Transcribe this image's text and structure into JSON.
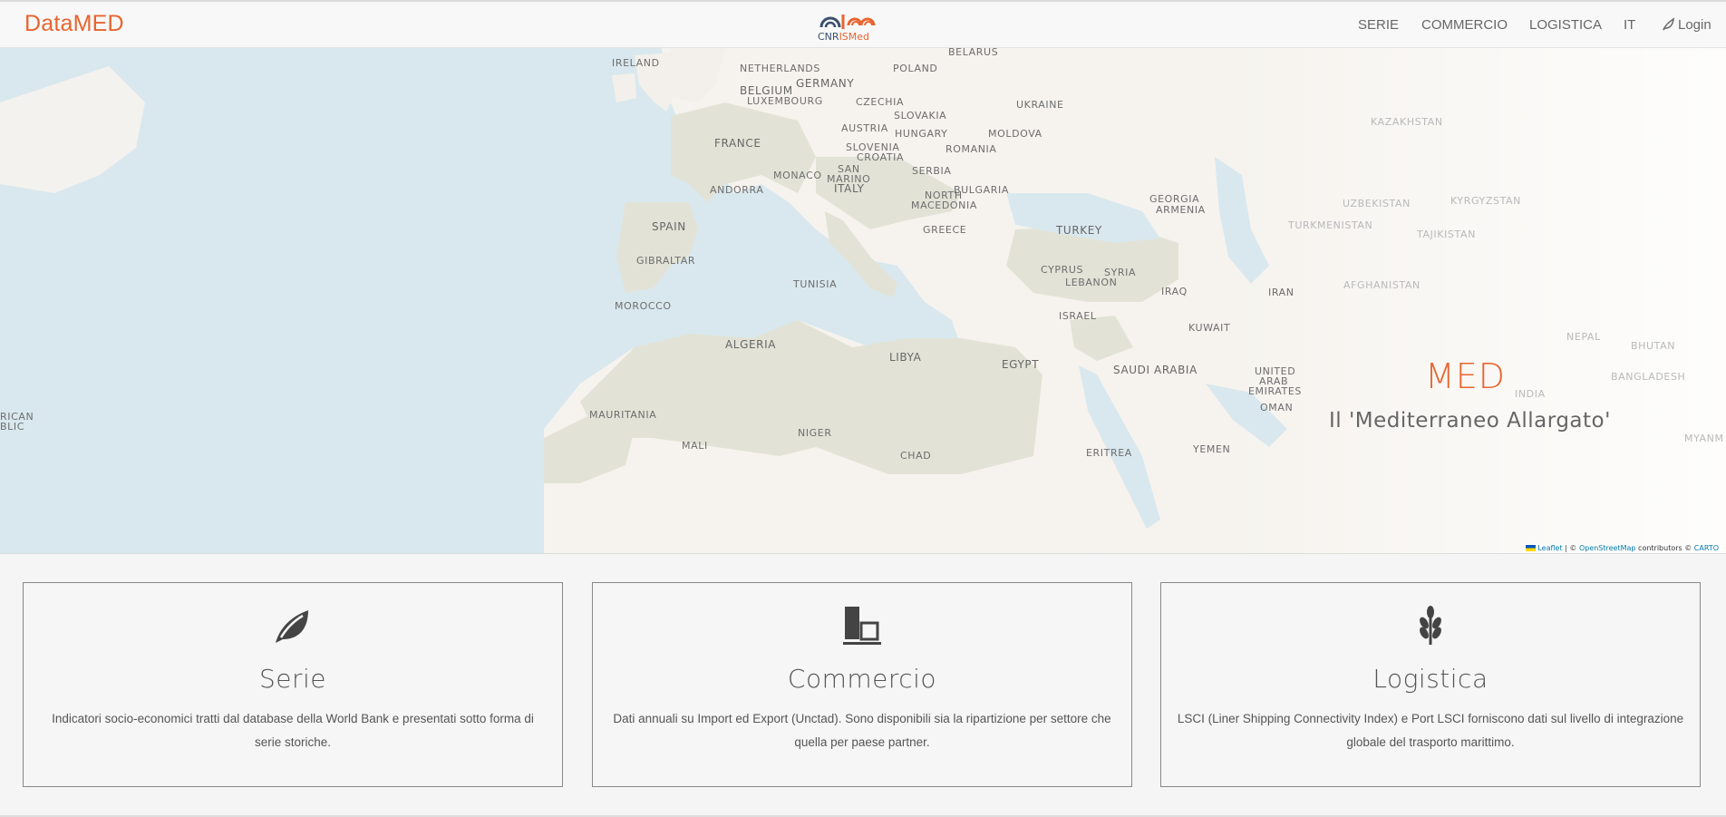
{
  "brand": "DataMED",
  "logo": {
    "left": "CNR",
    "right": "ISMed"
  },
  "nav": {
    "serie": "SERIE",
    "commercio": "COMMERCIO",
    "logistica": "LOGISTICA",
    "lang": "IT",
    "login": "Login"
  },
  "hero": {
    "title": "MED",
    "subtitle": "Il 'Mediterraneo Allargato'"
  },
  "map_labels": {
    "ireland": "IRELAND",
    "belarus": "BELARUS",
    "netherlands": "NETHERLANDS",
    "germany": "GERMANY",
    "poland": "POLAND",
    "belgium": "BELGIUM",
    "luxembourg": "LUXEMBOURG",
    "czechia": "CZECHIA",
    "ukraine": "UKRAINE",
    "slovakia": "SLOVAKIA",
    "austria": "AUSTRIA",
    "hungary": "HUNGARY",
    "moldova": "MOLDOVA",
    "kazakhstan": "KAZAKHSTAN",
    "france": "FRANCE",
    "slovenia": "SLOVENIA",
    "croatia": "CROATIA",
    "romania": "ROMANIA",
    "san": "SAN",
    "marino": "MARINO",
    "monaco": "MONACO",
    "serbia": "SERBIA",
    "andorra": "ANDORRA",
    "italy": "ITALY",
    "bulgaria": "BULGARIA",
    "north": "NORTH",
    "macedonia": "MACEDONIA",
    "georgia": "GEORGIA",
    "armenia": "ARMENIA",
    "uzbekistan": "UZBEKISTAN",
    "kyrgyzstan": "KYRGYZSTAN",
    "spain": "SPAIN",
    "greece": "GREECE",
    "turkey": "TURKEY",
    "turkmenistan": "TURKMENISTAN",
    "tajikistan": "TAJIKISTAN",
    "gibraltar": "GIBRALTAR",
    "cyprus": "CYPRUS",
    "syria": "SYRIA",
    "tunisia": "TUNISIA",
    "lebanon": "LEBANON",
    "afghanistan": "AFGHANISTAN",
    "iraq": "IRAQ",
    "iran": "IRAN",
    "morocco": "MOROCCO",
    "israel": "ISRAEL",
    "kuwait": "KUWAIT",
    "nepal": "NEPAL",
    "bhutan": "BHUTAN",
    "algeria": "ALGERIA",
    "libya": "LIBYA",
    "egypt": "EGYPT",
    "saudi_arabia": "SAUDI ARABIA",
    "united": "UNITED",
    "arab": "ARAB",
    "emirates": "EMIRATES",
    "bangladesh": "BANGLADESH",
    "india": "INDIA",
    "oman": "OMAN",
    "mauritania": "MAURITANIA",
    "niger": "NIGER",
    "mali": "MALI",
    "chad": "CHAD",
    "eritrea": "ERITREA",
    "yemen": "YEMEN",
    "myanmar": "MYANM",
    "rican": "RICAN",
    "blic": "BLIC"
  },
  "attribution": {
    "leaflet": "Leaflet",
    "sep": " | © ",
    "osm": "OpenStreetMap",
    "contrib": " contributors © ",
    "carto": "CARTO"
  },
  "cards": [
    {
      "title": "Serie",
      "desc": "Indicatori socio-economici tratti dal database della World Bank e presentati sotto forma di serie storiche.",
      "icon": "leaf-icon"
    },
    {
      "title": "Commercio",
      "desc": "Dati annuali su Import ed Export (Unctad). Sono disponibili sia la ripartizione per settore che quella per paese partner.",
      "icon": "building-icon"
    },
    {
      "title": "Logistica",
      "desc": "LSCI (Liner Shipping Connectivity Index) e Port LSCI forniscono dati sul livello di integrazione globale del trasporto marittimo.",
      "icon": "wheat-icon"
    }
  ],
  "colors": {
    "accent": "#e8652f",
    "sea": "#d9e8ee",
    "land": "#f6f3ee",
    "med_land": "#e2e3d6"
  }
}
